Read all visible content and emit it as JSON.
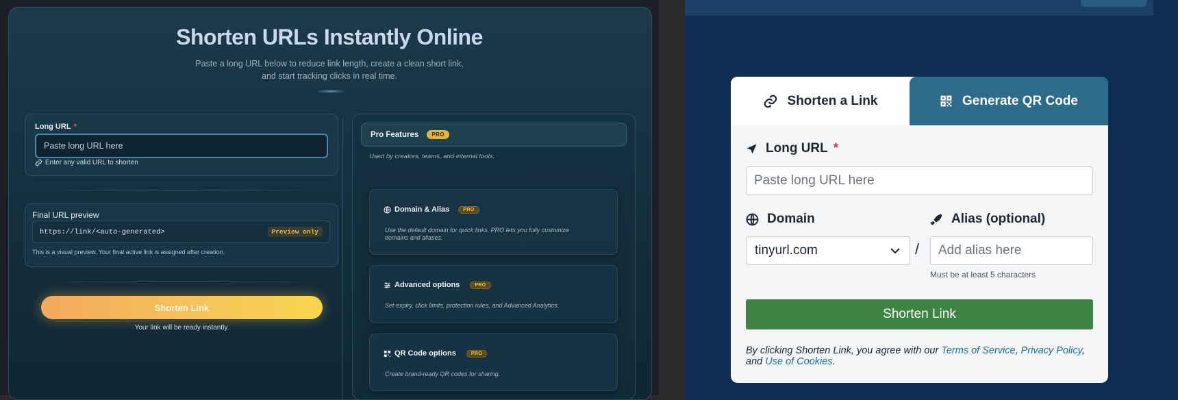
{
  "left": {
    "title": "Shorten URLs Instantly Online",
    "subtitle_line1": "Paste a long URL below to reduce link length, create a clean short link,",
    "subtitle_line2": "and start tracking clicks in real time.",
    "long_url": {
      "label": "Long URL",
      "required_mark": "*",
      "placeholder": "Paste long URL here",
      "hint": "Enter any valid URL to shorten"
    },
    "preview": {
      "title": "Final URL preview",
      "value": "https://link/<auto-generated>",
      "badge": "Preview only",
      "note": "This is a visual preview. Your final active link is assigned after creation."
    },
    "submit_label": "Shorten Link",
    "ready_text": "Your link will be ready instantly.",
    "pro": {
      "title": "Pro Features",
      "badge": "PRO",
      "subtitle": "Used by creators, teams, and internal tools.",
      "features": [
        {
          "title": "Domain & Alias",
          "badge": "PRO",
          "icon": "globe-icon",
          "desc_line1": "Use the default domain for quick links. PRO lets you fully customize",
          "desc_line2": "domains and aliases."
        },
        {
          "title": "Advanced options",
          "badge": "PRO",
          "icon": "sliders-icon",
          "desc_line1": "Set expiry, click limits, protection rules, and Advanced Analytics.",
          "desc_line2": ""
        },
        {
          "title": "QR Code options",
          "badge": "PRO",
          "icon": "qr-icon",
          "desc_line1": "Create brand-ready QR codes for sharing.",
          "desc_line2": ""
        }
      ]
    }
  },
  "right": {
    "tabs": [
      {
        "label": "Shorten a Link",
        "icon": "link-icon",
        "active": true
      },
      {
        "label": "Generate QR Code",
        "icon": "qr-icon",
        "active": false
      }
    ],
    "long_url_label": "Long URL",
    "required_mark": "*",
    "long_url_placeholder": "Paste long URL here",
    "domain_label": "Domain",
    "domain_value": "tinyurl.com",
    "slash": "/",
    "alias_label": "Alias (optional)",
    "alias_placeholder": "Add alias here",
    "alias_hint": "Must be at least 5 characters",
    "submit_label": "Shorten Link",
    "terms_prefix": "By clicking Shorten Link, you agree with our ",
    "terms_link": "Terms of Service",
    "terms_comma": ", ",
    "privacy_link": "Privacy Policy",
    "terms_and": ", and ",
    "cookies_link": "Use of Cookies",
    "terms_end": ".",
    "colors": {
      "tab_active_bg": "#ffffff",
      "tab_inactive_bg": "#2e6b8a",
      "button_green": "#3e8543",
      "link_blue": "#1e6e97",
      "required_red": "#d9343f"
    }
  }
}
